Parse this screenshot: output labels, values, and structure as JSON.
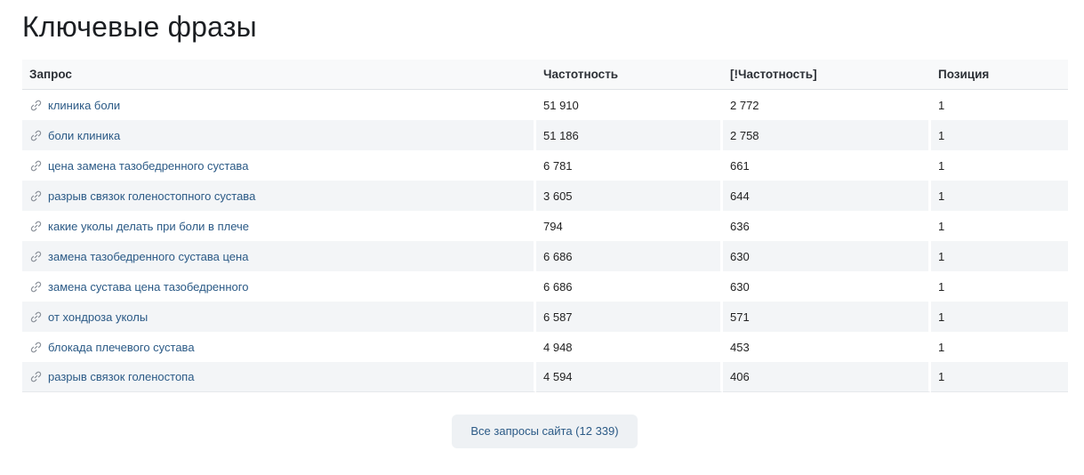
{
  "title": "Ключевые фразы",
  "table": {
    "headers": {
      "query": "Запрос",
      "freq": "Частотность",
      "exact_freq": "[!Частотность]",
      "position": "Позиция"
    },
    "rows": [
      {
        "query": "клиника боли",
        "freq": "51 910",
        "exact_freq": "2 772",
        "position": "1"
      },
      {
        "query": "боли клиника",
        "freq": "51 186",
        "exact_freq": "2 758",
        "position": "1"
      },
      {
        "query": "цена замена тазобедренного сустава",
        "freq": "6 781",
        "exact_freq": "661",
        "position": "1"
      },
      {
        "query": "разрыв связок голеностопного сустава",
        "freq": "3 605",
        "exact_freq": "644",
        "position": "1"
      },
      {
        "query": "какие уколы делать при боли в плече",
        "freq": "794",
        "exact_freq": "636",
        "position": "1"
      },
      {
        "query": "замена тазобедренного сустава цена",
        "freq": "6 686",
        "exact_freq": "630",
        "position": "1"
      },
      {
        "query": "замена сустава цена тазобедренного",
        "freq": "6 686",
        "exact_freq": "630",
        "position": "1"
      },
      {
        "query": "от хондроза уколы",
        "freq": "6 587",
        "exact_freq": "571",
        "position": "1"
      },
      {
        "query": "блокада плечевого сустава",
        "freq": "4 948",
        "exact_freq": "453",
        "position": "1"
      },
      {
        "query": "разрыв связок голеностопа",
        "freq": "4 594",
        "exact_freq": "406",
        "position": "1"
      }
    ]
  },
  "all_queries_button": "Все запросы сайта (12 339)",
  "icons": {
    "row_link": "link-icon"
  },
  "colors": {
    "link": "#2b5a86",
    "row_alt": "#f3f5f7",
    "header_bg": "#f8f9fa",
    "button_bg": "#eef1f4"
  }
}
